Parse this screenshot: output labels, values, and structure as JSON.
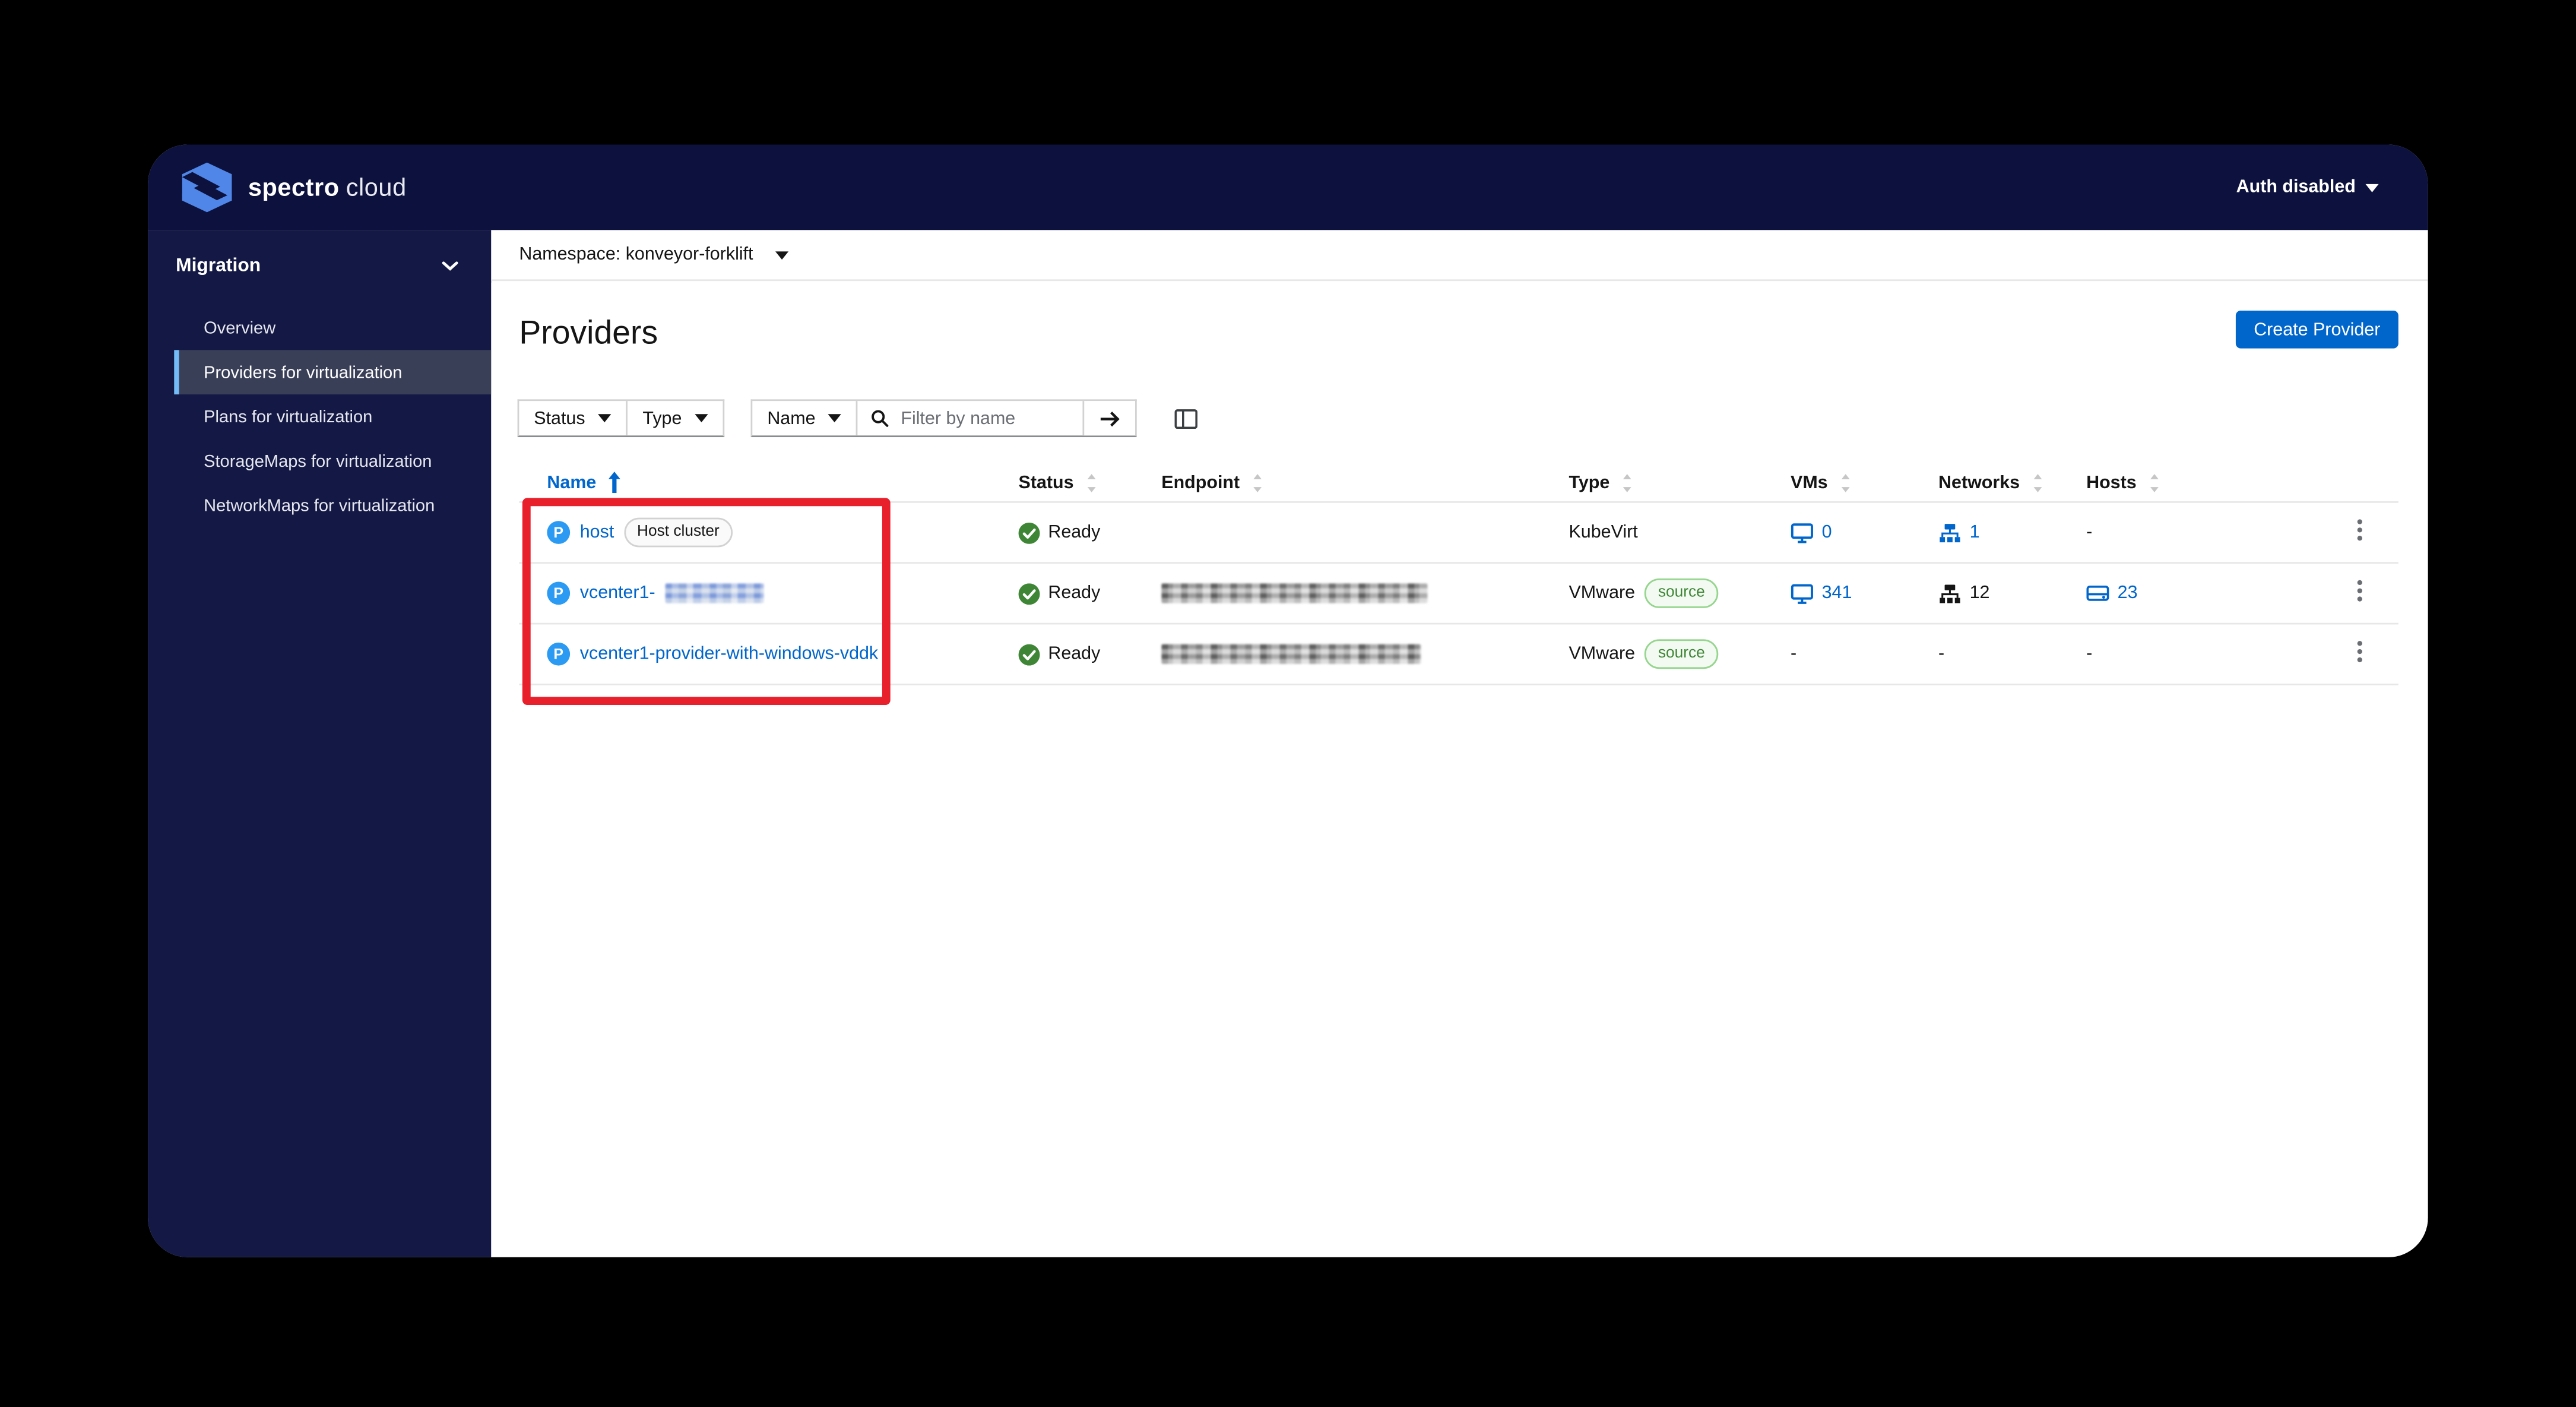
{
  "masthead": {
    "brand_primary": "spectro",
    "brand_secondary": "cloud",
    "auth_menu": "Auth disabled"
  },
  "sidebar": {
    "group_label": "Migration",
    "items": [
      {
        "label": "Overview"
      },
      {
        "label": "Providers for virtualization"
      },
      {
        "label": "Plans for virtualization"
      },
      {
        "label": "StorageMaps for virtualization"
      },
      {
        "label": "NetworkMaps for virtualization"
      }
    ],
    "selected_item": "Providers for virtualization"
  },
  "namespace_bar": {
    "label": "Namespace: konveyor-forklift"
  },
  "page": {
    "title": "Providers",
    "create_button_label": "Create Provider"
  },
  "toolbar": {
    "status_dropdown": "Status",
    "type_dropdown": "Type",
    "name_dropdown": "Name",
    "search_placeholder": "Filter by name"
  },
  "table": {
    "headers": {
      "name": "Name",
      "status": "Status",
      "endpoint": "Endpoint",
      "type": "Type",
      "vms": "VMs",
      "networks": "Networks",
      "hosts": "Hosts"
    },
    "sort": {
      "column": "Name",
      "direction": "ascending"
    },
    "rows": [
      {
        "name": "host",
        "name_badge": "Host cluster",
        "status": "Ready",
        "endpoint": "",
        "type": "KubeVirt",
        "type_badge": "",
        "vms": "0",
        "networks": "1",
        "hosts": "-"
      },
      {
        "name": "vcenter1-",
        "name_redacted": true,
        "status": "Ready",
        "endpoint_redacted": true,
        "type": "VMware",
        "type_badge": "source",
        "vms": "341",
        "networks": "12",
        "hosts": "23"
      },
      {
        "name": "vcenter1-provider-with-windows-vddk",
        "status": "Ready",
        "endpoint_redacted": true,
        "type": "VMware",
        "type_badge": "source",
        "vms": "-",
        "networks": "-",
        "hosts": "-"
      }
    ]
  },
  "icons": {
    "provider_letter": "P"
  },
  "annotation": {
    "color": "#e8202c"
  },
  "colors": {
    "masthead_navy": "#0d113d",
    "sidebar_navy": "#131845",
    "selected_nav_bg": "#3a3f58",
    "selected_nav_bar": "#73bcf7",
    "link_blue": "#0066cc",
    "button_blue": "#0066cc",
    "provider_icon_blue": "#2b9af3",
    "success_green": "#3e8635",
    "source_badge_bg": "#f3faf2",
    "source_badge_border": "#95d58e",
    "annotation_red": "#e8202c"
  }
}
